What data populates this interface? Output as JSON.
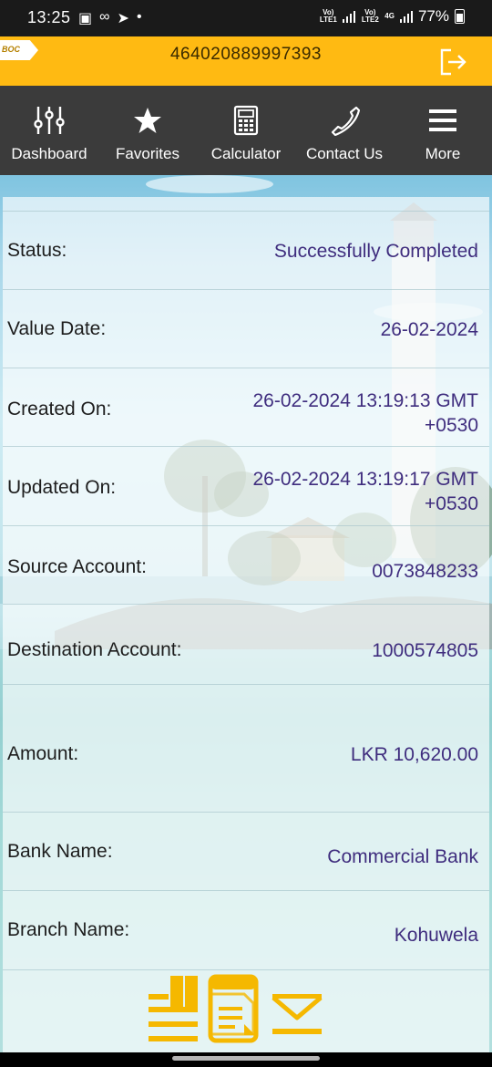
{
  "status_bar": {
    "time": "13:25",
    "net1": "Vo) LTE1",
    "net2": "Vo) LTE2",
    "net_type": "4G",
    "battery": "77%"
  },
  "header": {
    "logo_text": "BOC",
    "account_number": "464020889997393",
    "brand_color": "#ffba12"
  },
  "nav": {
    "items": [
      {
        "label": "Dashboard",
        "icon": "sliders-icon"
      },
      {
        "label": "Favorites",
        "icon": "star-icon"
      },
      {
        "label": "Calculator",
        "icon": "calculator-icon"
      },
      {
        "label": "Contact Us",
        "icon": "phone-icon"
      },
      {
        "label": "More",
        "icon": "menu-icon"
      }
    ]
  },
  "details": [
    {
      "label": "Status:",
      "value": "Successfully Completed"
    },
    {
      "label": "Value Date:",
      "value": "26-02-2024"
    },
    {
      "label": "Created On:",
      "value": "26-02-2024 13:19:13 GMT",
      "value2": "+0530"
    },
    {
      "label": "Updated On:",
      "value": "26-02-2024 13:19:17 GMT",
      "value2": "+0530"
    },
    {
      "label": "Source Account:",
      "value": "0073848233"
    },
    {
      "label": "Destination Account:",
      "value": "1000574805"
    },
    {
      "label": "Amount:",
      "value": "LKR 10,620.00"
    },
    {
      "label": "Bank Name:",
      "value": "Commercial Bank"
    },
    {
      "label": "Branch Name:",
      "value": "Kohuwela"
    }
  ],
  "bottom_actions": [
    {
      "icon": "receipt-icon"
    },
    {
      "icon": "copy-document-icon"
    },
    {
      "icon": "mail-icon"
    }
  ],
  "colors": {
    "value_text": "#3f2d7e",
    "navbar_bg": "#3b3b3b",
    "accent": "#ffba12"
  }
}
